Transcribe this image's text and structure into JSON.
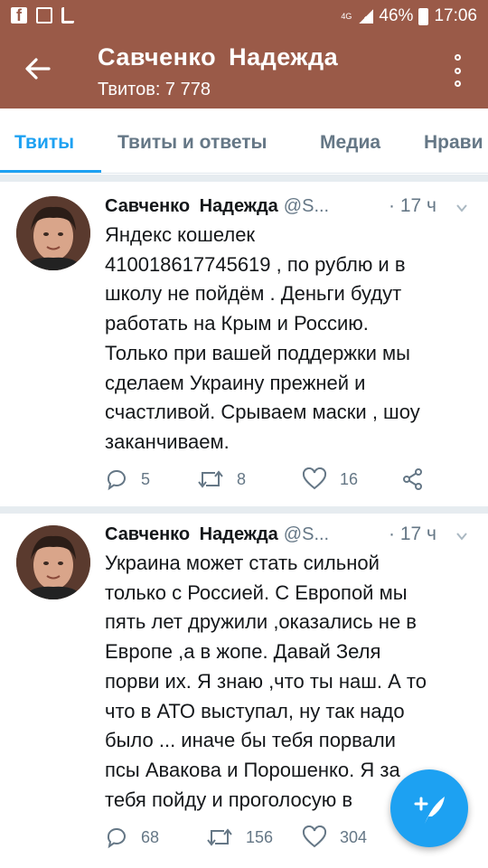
{
  "status_bar": {
    "network": "4G",
    "battery": "46%",
    "time": "17:06"
  },
  "app_bar": {
    "title": "Савченко  Надежда",
    "subtitle": "Твитов: 7 778"
  },
  "tabs": [
    {
      "label": "Твиты",
      "active": true
    },
    {
      "label": "Твиты и ответы",
      "active": false
    },
    {
      "label": "Медиа",
      "active": false
    },
    {
      "label": "Нрави",
      "active": false
    }
  ],
  "tweets": [
    {
      "name": "Савченко  Надежда",
      "handle": "@S...",
      "time": "· 17 ч",
      "lines": [
        "Яндекс кошелек",
        "410018617745619 , по рублю и в",
        "школу не пойдём . Деньги будут",
        "работать на Крым и Россию.",
        "Только при вашей поддержки мы",
        "сделаем Украину прежней и",
        "счастливой. Срываем маски , шоу",
        "заканчиваем."
      ],
      "replies": "5",
      "retweets": "8",
      "likes": "16"
    },
    {
      "name": "Савченко  Надежда",
      "handle": "@S...",
      "time": "· 17 ч",
      "lines": [
        "Украина может стать сильной",
        "только с Россией. С Европой мы",
        "пять лет дружили ,оказались не в",
        "Европе ,а в жопе. Давай Зеля",
        "порви их. Я знаю ,что ты наш. А то",
        "что в АТО выступал, ну так надо",
        "было ... иначе бы тебя порвали",
        "псы Авакова и Порошенко. Я за",
        "тебя пойду и проголосую в"
      ],
      "replies": "68",
      "retweets": "156",
      "likes": "304"
    }
  ],
  "colors": {
    "app_bar": "#9a5a48",
    "accent": "#1da1f2",
    "muted": "#657786"
  },
  "icons": [
    "back-arrow-icon",
    "overflow-menu-icon",
    "reply-icon",
    "retweet-icon",
    "like-icon",
    "share-icon",
    "compose-icon"
  ]
}
